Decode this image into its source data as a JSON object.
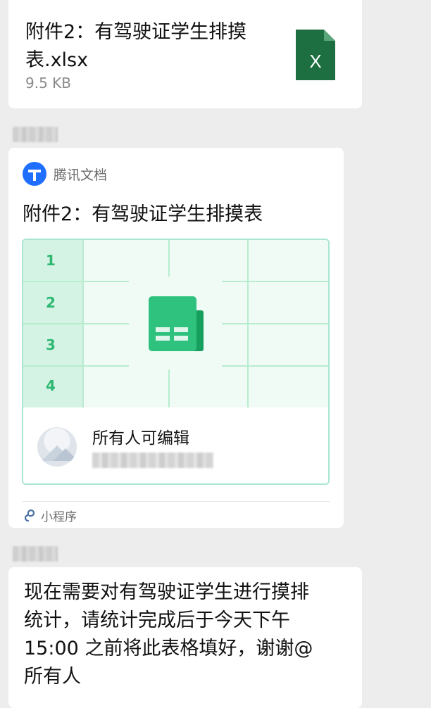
{
  "file_message": {
    "file_name": "附件2：有驾驶证学生排摸表.xlsx",
    "file_size": "9.5 KB",
    "file_icon": "excel-file-icon",
    "file_icon_letter": "X",
    "icon_color": "#1d6f42"
  },
  "doc_card": {
    "app_name": "腾讯文档",
    "app_icon": "tencent-docs-icon",
    "title": "附件2：有驾驶证学生排摸表",
    "row_numbers": [
      "1",
      "2",
      "3",
      "4"
    ],
    "permission": "所有人可编辑",
    "mini_program_label": "小程序",
    "accent_color": "#2eb872"
  },
  "text_message": {
    "text": "现在需要对有驾驶证学生进行摸排\n统计，请统计完成后于今天下午\n15:00 之前将此表格填好，谢谢@\n所有人"
  },
  "colors": {
    "background": "#ededed",
    "bubble": "#ffffff"
  }
}
